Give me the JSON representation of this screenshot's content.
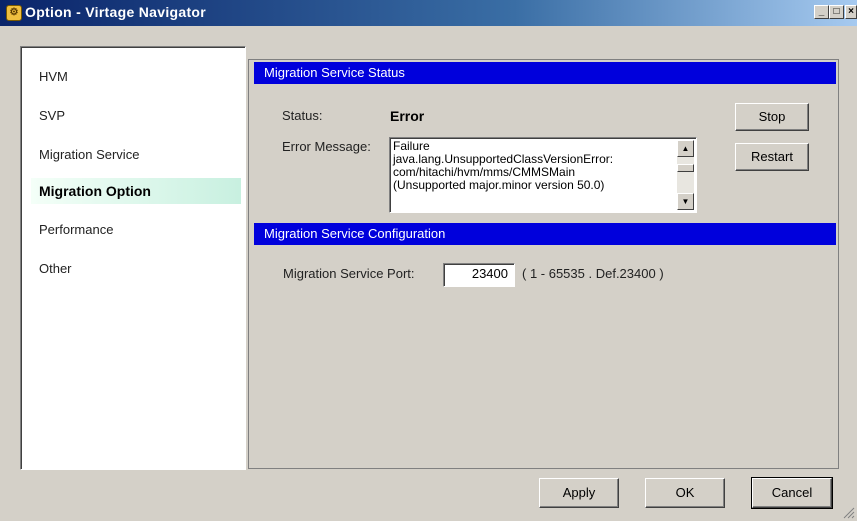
{
  "window": {
    "title": "Option - Virtage Navigator",
    "minimize": "_",
    "maximize": "□",
    "close": "×"
  },
  "sidebar": {
    "items": [
      {
        "label": "HVM"
      },
      {
        "label": "SVP"
      },
      {
        "label": "Migration Service"
      },
      {
        "label": "Migration Option"
      },
      {
        "label": "Performance"
      },
      {
        "label": "Other"
      }
    ],
    "selected": "Migration Option"
  },
  "status_section": {
    "header": "Migration Service Status",
    "status_label": "Status:",
    "status_value": "Error",
    "error_label": "Error Message:",
    "error_text": "Failure\njava.lang.UnsupportedClassVersionError:\ncom/hitachi/hvm/mms/CMMSMain\n(Unsupported major.minor version 50.0)",
    "stop_label": "Stop",
    "restart_label": "Restart"
  },
  "config_section": {
    "header": "Migration Service Configuration",
    "port_label": "Migration Service Port:",
    "port_value": "23400",
    "port_hint": "( 1 - 65535 . Def.23400 )"
  },
  "footer": {
    "apply_label": "Apply",
    "ok_label": "OK",
    "cancel_label": "Cancel"
  },
  "colors": {
    "section_header": "#0000dc",
    "title_bar": "#0a246a",
    "selected_item": "#c8f0e0"
  }
}
